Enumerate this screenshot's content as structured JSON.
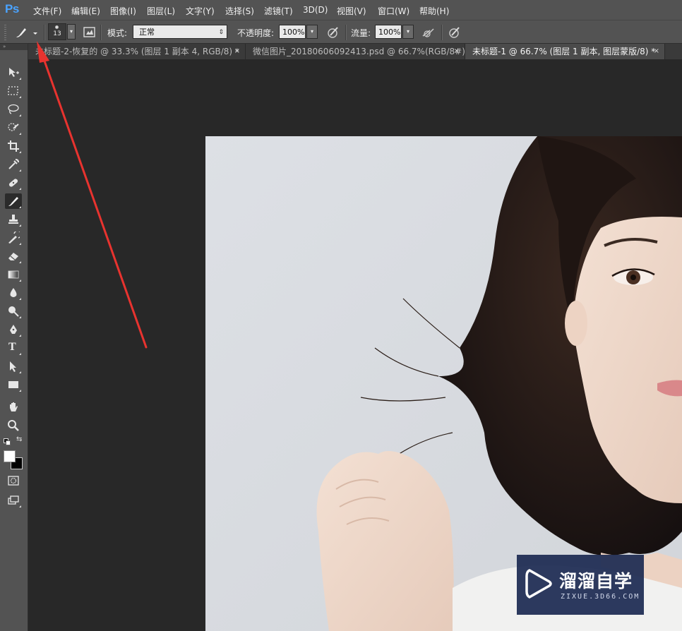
{
  "app": {
    "logo": "Ps"
  },
  "menu": [
    "文件(F)",
    "编辑(E)",
    "图像(I)",
    "图层(L)",
    "文字(Y)",
    "选择(S)",
    "滤镜(T)",
    "3D(D)",
    "视图(V)",
    "窗口(W)",
    "帮助(H)"
  ],
  "options": {
    "brush_size": "13",
    "mode_label": "模式:",
    "mode_value": "正常",
    "opacity_label": "不透明度:",
    "opacity_value": "100%",
    "flow_label": "流量:",
    "flow_value": "100%"
  },
  "tabs": [
    {
      "title": "未标题-2-恢复的 @ 33.3% (图层 1 副本 4, RGB/8) *",
      "close": "×",
      "active": false
    },
    {
      "title": "微信图片_20180606092413.psd @ 66.7%(RGB/8#) *",
      "close": "×",
      "active": false
    },
    {
      "title": "未标题-1 @ 66.7% (图层 1 副本, 图层蒙版/8) *",
      "close": "×",
      "active": true
    }
  ],
  "toolbar": {
    "collapse_glyph": "»",
    "tools": [
      "move-tool",
      "marquee-tool",
      "lasso-tool",
      "quick-select-tool",
      "crop-tool",
      "eyedropper-tool",
      "healing-brush-tool",
      "brush-tool",
      "clone-stamp-tool",
      "history-brush-tool",
      "eraser-tool",
      "gradient-tool",
      "blur-tool",
      "dodge-tool",
      "pen-tool",
      "type-tool",
      "path-select-tool",
      "rectangle-tool",
      "hand-tool",
      "zoom-tool"
    ],
    "active_tool": "brush-tool",
    "type_glyph": "T",
    "foreground_color": "#ffffff",
    "background_color": "#000000"
  },
  "watermark": {
    "title": "溜溜自学",
    "subtitle": "ZIXUE.3D66.COM"
  },
  "colors": {
    "annotation_arrow": "#e8332f",
    "ps_logo": "#4aa3ff",
    "canvas_background": "#282828"
  }
}
